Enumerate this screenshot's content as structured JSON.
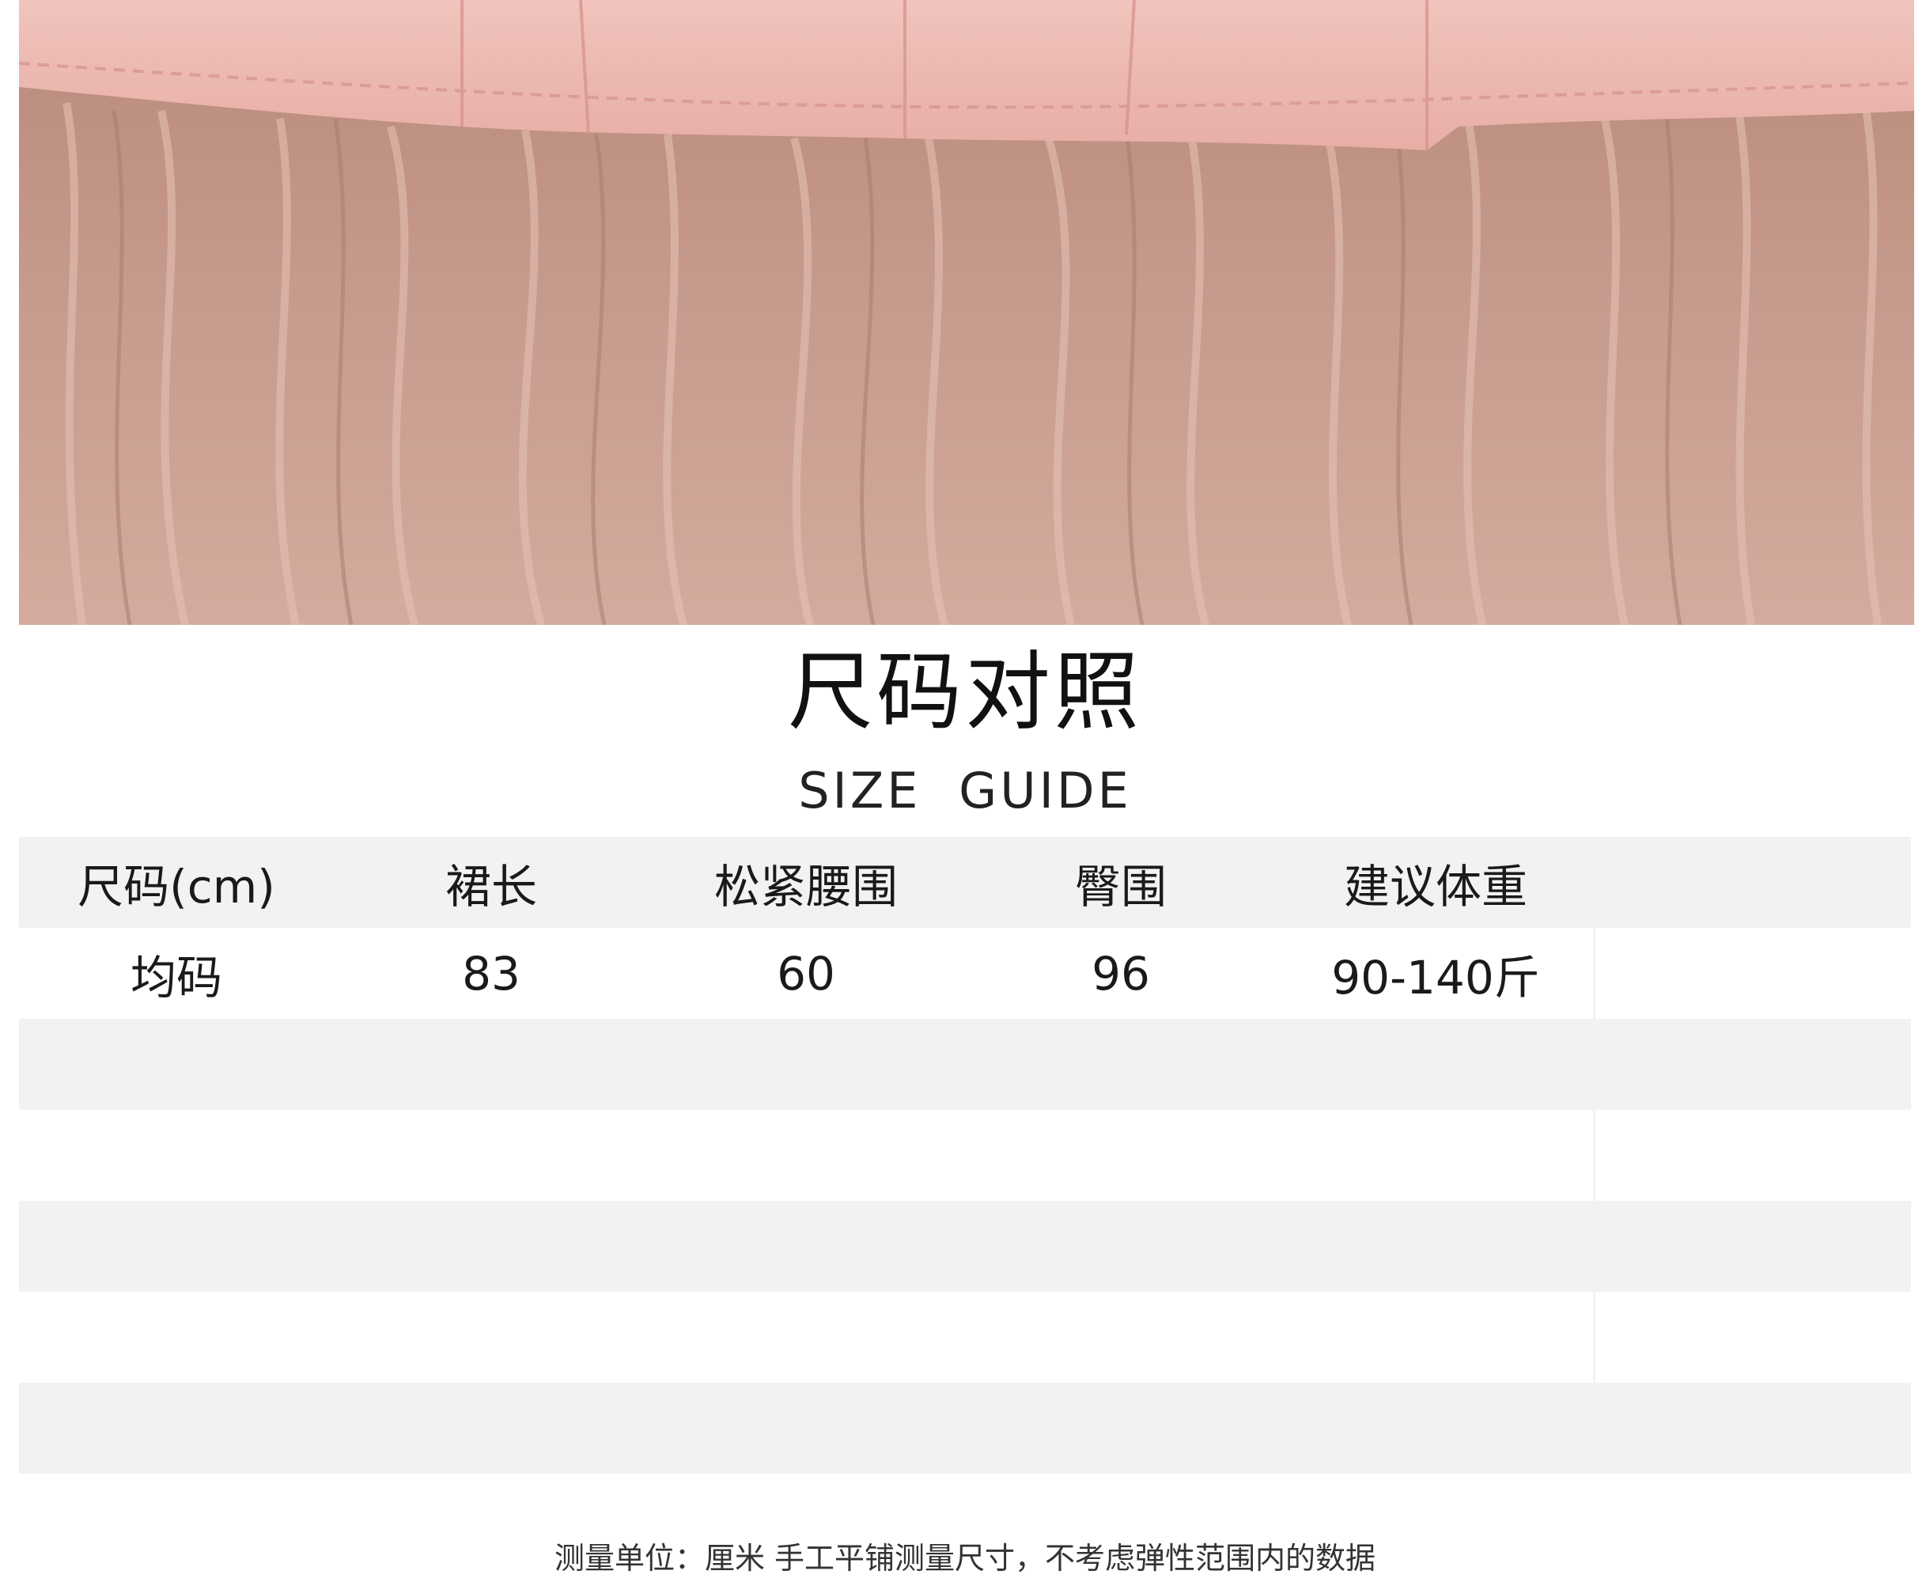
{
  "photo": {
    "subject": "pink-tulle-skirt-hem-photo"
  },
  "title": "尺码对照",
  "subtitle": "SIZE  GUIDE",
  "table": {
    "headers": [
      "尺码(cm)",
      "裙长",
      "松紧腰围",
      "臀围",
      "建议体重",
      ""
    ],
    "rows": [
      [
        "均码",
        "83",
        "60",
        "96",
        "90-140斤",
        ""
      ],
      [
        "",
        "",
        "",
        "",
        "",
        ""
      ],
      [
        "",
        "",
        "",
        "",
        "",
        ""
      ],
      [
        "",
        "",
        "",
        "",
        "",
        ""
      ],
      [
        "",
        "",
        "",
        "",
        "",
        ""
      ],
      [
        "",
        "",
        "",
        "",
        "",
        ""
      ]
    ]
  },
  "note": "测量单位：厘米 手工平铺测量尺寸，不考虑弹性范围内的数据",
  "colors": {
    "row_gray": "#f2f2f2",
    "fabric_pink": "#e9b7b0",
    "tulle": "#c99a8c"
  }
}
